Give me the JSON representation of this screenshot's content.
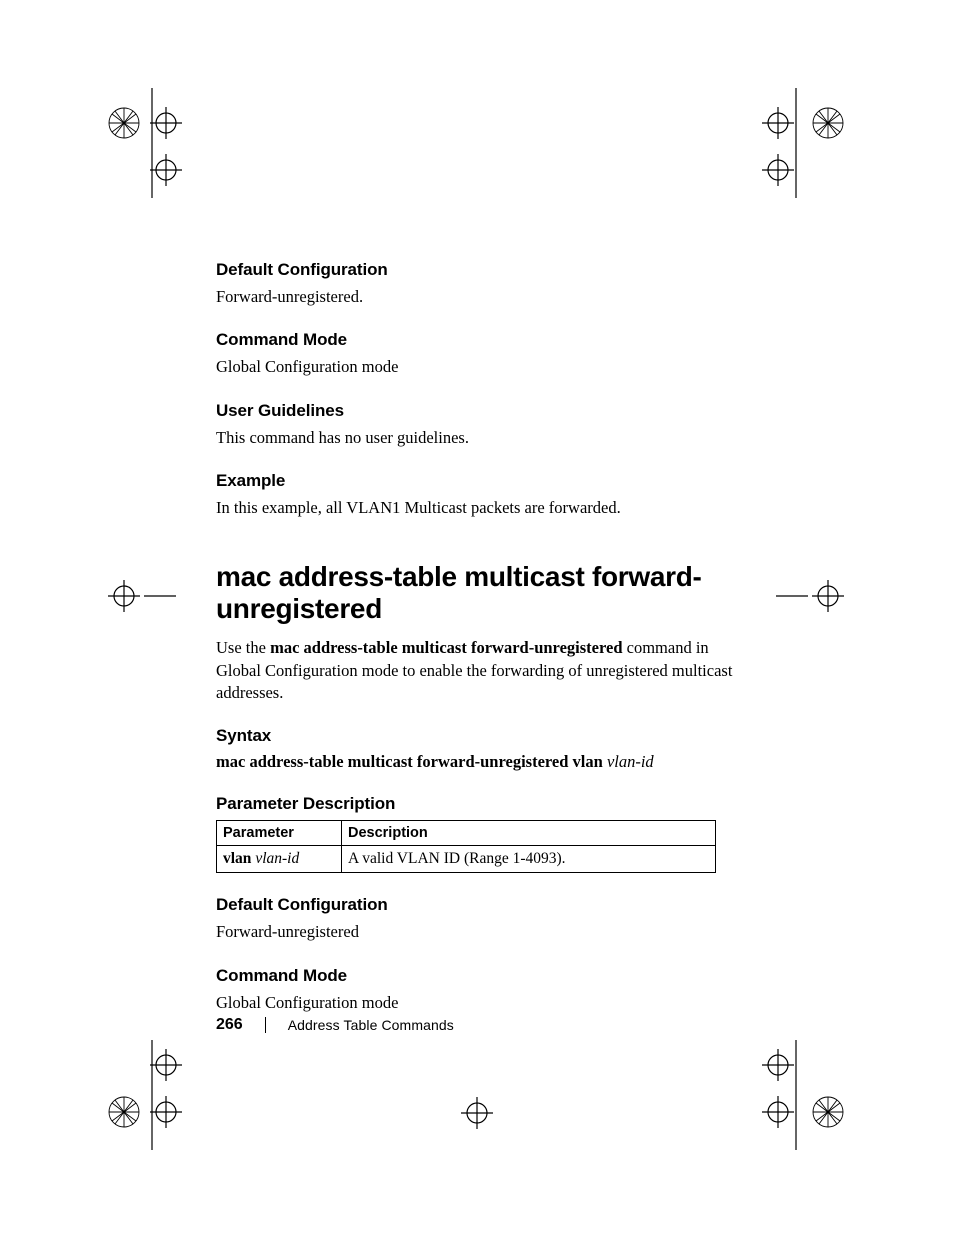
{
  "sections": {
    "s1": {
      "heading": "Default Configuration",
      "body": "Forward-unregistered."
    },
    "s2": {
      "heading": "Command Mode",
      "body": "Global Configuration mode"
    },
    "s3": {
      "heading": "User Guidelines",
      "body": "This command has no user guidelines."
    },
    "s4": {
      "heading": "Example",
      "body": "In this example, all VLAN1 Multicast packets are forwarded."
    }
  },
  "command": {
    "title": "mac address-table multicast forward-unregistered",
    "intro_pre": "Use the ",
    "intro_bold": "mac address-table multicast forward-unregistered",
    "intro_post": " command in Global Configuration mode to enable the forwarding of unregistered multicast addresses."
  },
  "syntax": {
    "heading": "Syntax",
    "bold": "mac address-table multicast forward-unregistered vlan ",
    "italic": "vlan-id"
  },
  "param": {
    "heading": "Parameter Description",
    "th1": "Parameter",
    "th2": "Description",
    "row1_bold": "vlan ",
    "row1_italic": "vlan-id",
    "row1_desc": "A valid VLAN ID (Range 1-4093)."
  },
  "sections2": {
    "s5": {
      "heading": "Default Configuration",
      "body": "Forward-unregistered"
    },
    "s6": {
      "heading": "Command Mode",
      "body": "Global Configuration mode"
    }
  },
  "footer": {
    "page": "266",
    "section": "Address Table Commands"
  }
}
